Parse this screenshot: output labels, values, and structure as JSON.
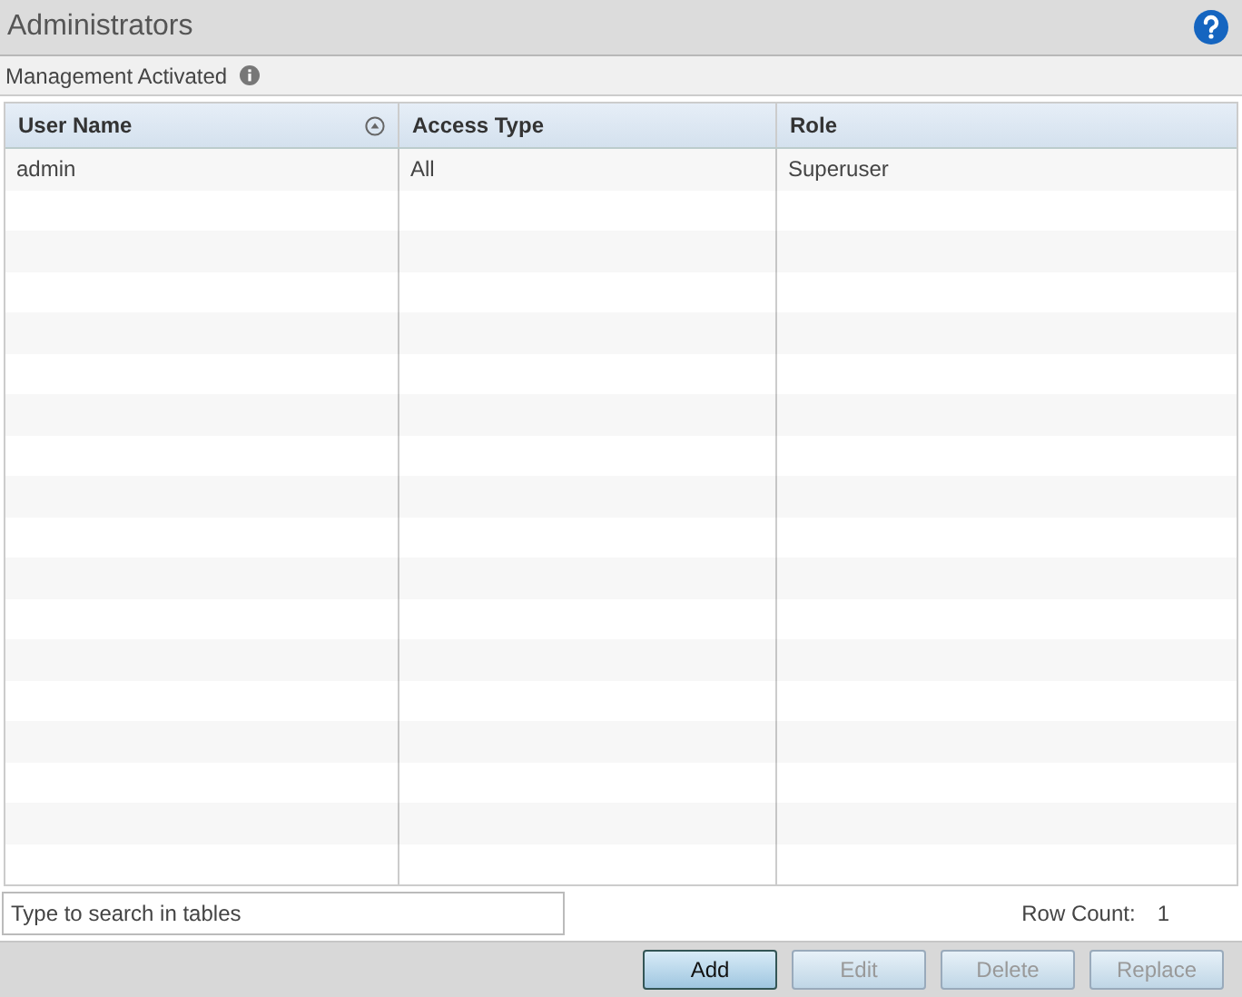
{
  "window": {
    "title": "Administrators"
  },
  "subheader": {
    "label": "Management Activated"
  },
  "table": {
    "columns": [
      {
        "label": "User Name",
        "sorted": true
      },
      {
        "label": "Access Type",
        "sorted": false
      },
      {
        "label": "Role",
        "sorted": false
      }
    ],
    "rows": [
      [
        "admin",
        "All",
        "Superuser"
      ]
    ]
  },
  "search": {
    "placeholder": "Type to search in tables"
  },
  "row_count": {
    "label": "Row Count:",
    "value": "1"
  },
  "buttons": [
    {
      "label": "Add",
      "disabled": false
    },
    {
      "label": "Edit",
      "disabled": true
    },
    {
      "label": "Delete",
      "disabled": true
    },
    {
      "label": "Replace",
      "disabled": true
    }
  ]
}
